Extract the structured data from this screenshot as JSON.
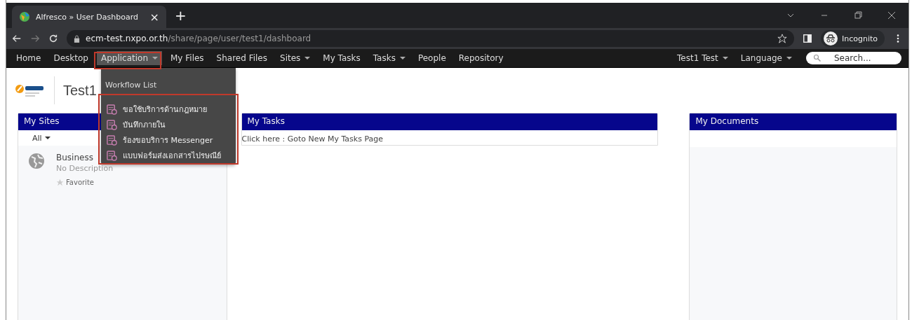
{
  "browser": {
    "tab_title": "Alfresco » User Dashboard",
    "tab_close": "×",
    "new_tab": "+",
    "url_host": "ecm-test.nxpo.or.th",
    "url_path": "/share/page/user/test1/dashboard",
    "profile": "Incognito"
  },
  "nav": {
    "items": [
      {
        "label": "Home",
        "dropdown": false,
        "selected": false
      },
      {
        "label": "Desktop",
        "dropdown": false,
        "selected": false
      },
      {
        "label": "Application",
        "dropdown": true,
        "selected": true
      },
      {
        "label": "My Files",
        "dropdown": false,
        "selected": false
      },
      {
        "label": "Shared Files",
        "dropdown": false,
        "selected": false
      },
      {
        "label": "Sites",
        "dropdown": true,
        "selected": false
      },
      {
        "label": "My Tasks",
        "dropdown": false,
        "selected": false
      },
      {
        "label": "Tasks",
        "dropdown": true,
        "selected": false
      },
      {
        "label": "People",
        "dropdown": false,
        "selected": false
      },
      {
        "label": "Repository",
        "dropdown": false,
        "selected": false
      }
    ],
    "right_items": [
      {
        "label": "Test1 Test",
        "dropdown": true
      },
      {
        "label": "Language",
        "dropdown": true
      }
    ],
    "search_placeholder": "Search..."
  },
  "menu": {
    "heading": "Workflow List",
    "items": [
      "ขอใช้บริการด้านกฎหมาย",
      "บันทึกภายใน",
      "ร้องขอบริการ Messenger",
      "แบบฟอร์มส่งเอกสารไปรษณีย์"
    ]
  },
  "dashboard": {
    "title": "Test1"
  },
  "my_sites": {
    "title": "My Sites",
    "filter": "All",
    "sites": [
      {
        "name": "Business",
        "description": "No Description",
        "favorite": "Favorite"
      }
    ]
  },
  "my_tasks": {
    "title": "My Tasks",
    "link": "Click here : Goto New My Tasks Page"
  },
  "my_documents": {
    "title": "My Documents"
  }
}
